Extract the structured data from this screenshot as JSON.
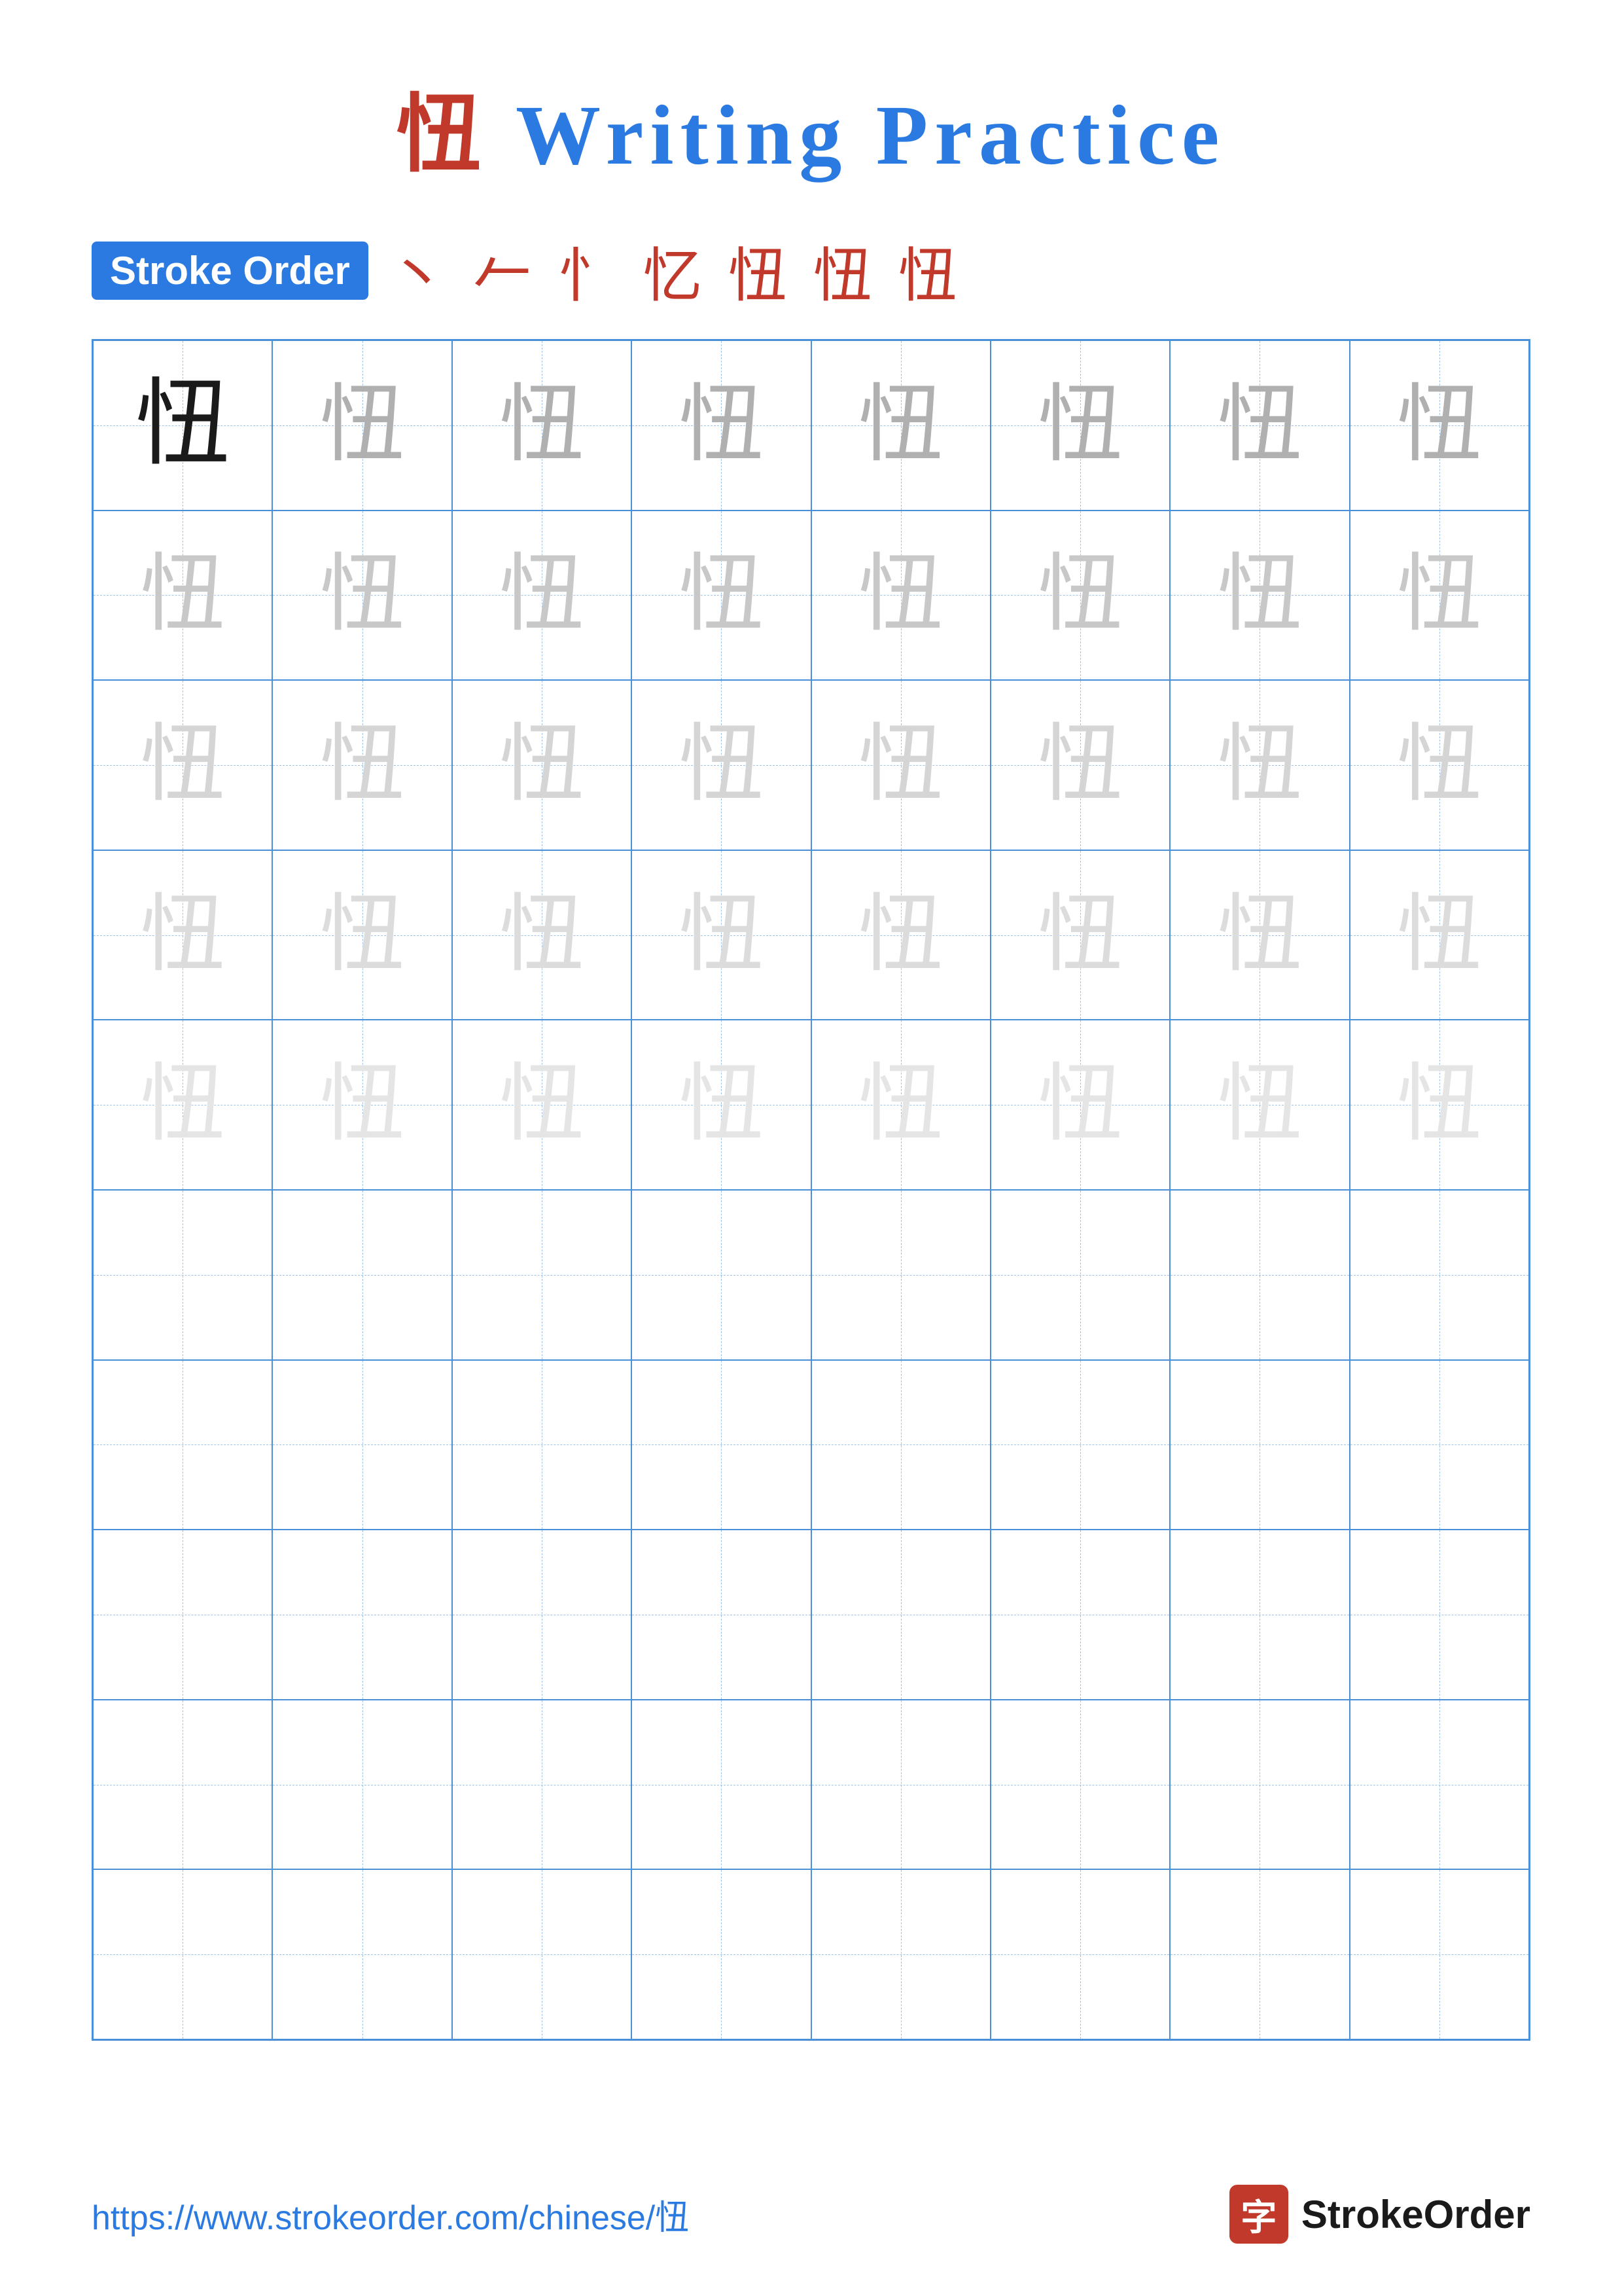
{
  "title": {
    "prefix_char": "忸",
    "text": " Writing Practice"
  },
  "stroke_order": {
    "label": "Stroke Order",
    "chars": [
      "、",
      "𠂉",
      "忄",
      "忆",
      "忸",
      "忸",
      "忸"
    ]
  },
  "character": "忸",
  "grid": {
    "cols": 8,
    "rows": 10,
    "guide_rows": 5,
    "empty_rows": 5
  },
  "footer": {
    "url": "https://www.strokeorder.com/chinese/忸",
    "brand": "StrokeOrder"
  }
}
